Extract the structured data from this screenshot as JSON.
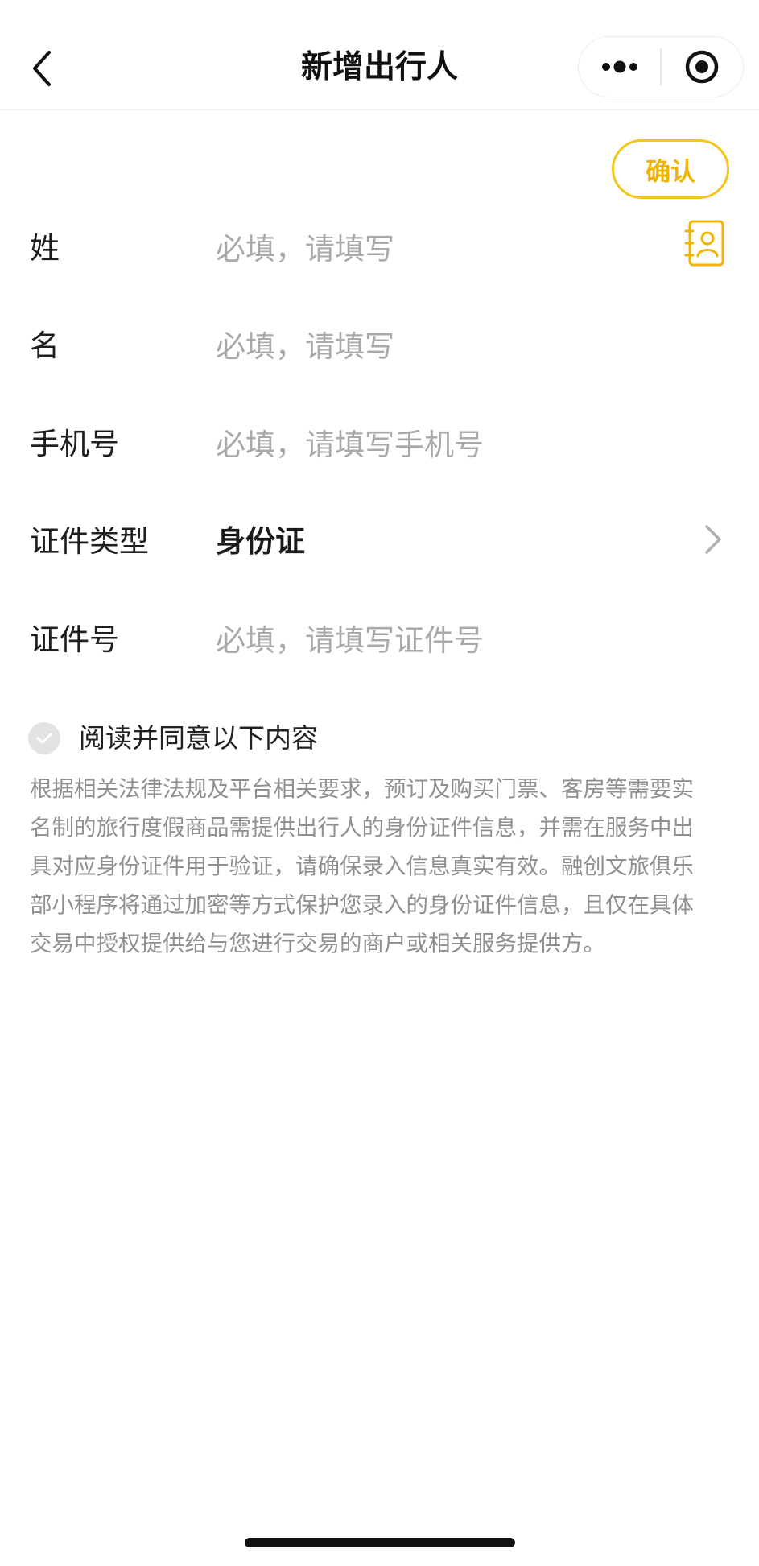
{
  "navbar": {
    "title": "新增出行人",
    "back_icon": "chevron-left-icon",
    "menu_icon": "more-dots-icon",
    "close_icon": "target-circle-icon"
  },
  "actions": {
    "confirm_label": "确认",
    "contacts_icon": "contacts-book-icon"
  },
  "form": {
    "surname": {
      "label": "姓",
      "placeholder": "必填，请填写",
      "value": ""
    },
    "given_name": {
      "label": "名",
      "placeholder": "必填，请填写",
      "value": ""
    },
    "phone": {
      "label": "手机号",
      "placeholder": "必填，请填写手机号",
      "value": ""
    },
    "id_type": {
      "label": "证件类型",
      "value": "身份证"
    },
    "id_number": {
      "label": "证件号",
      "placeholder": "必填，请填写证件号",
      "value": ""
    }
  },
  "agreement": {
    "checkbox_label": "阅读并同意以下内容",
    "checked": false,
    "lines": [
      "根据相关法律法规及平台相关要求，预订及购买门票、客房等需要实",
      "名制的旅行度假商品需提供出行人的身份证件信息，并需在服务中出",
      "具对应身份证件用于验证，请确保录入信息真实有效。融创文旅俱乐",
      "部小程序将通过加密等方式保护您录入的身份证件信息，且仅在具体",
      "交易中授权提供给与您进行交易的商户或相关服务提供方。"
    ]
  },
  "colors": {
    "accent": "#f5c518",
    "accent_text": "#f0b400",
    "placeholder": "#a9a9a9",
    "description": "#8f8f8f"
  }
}
